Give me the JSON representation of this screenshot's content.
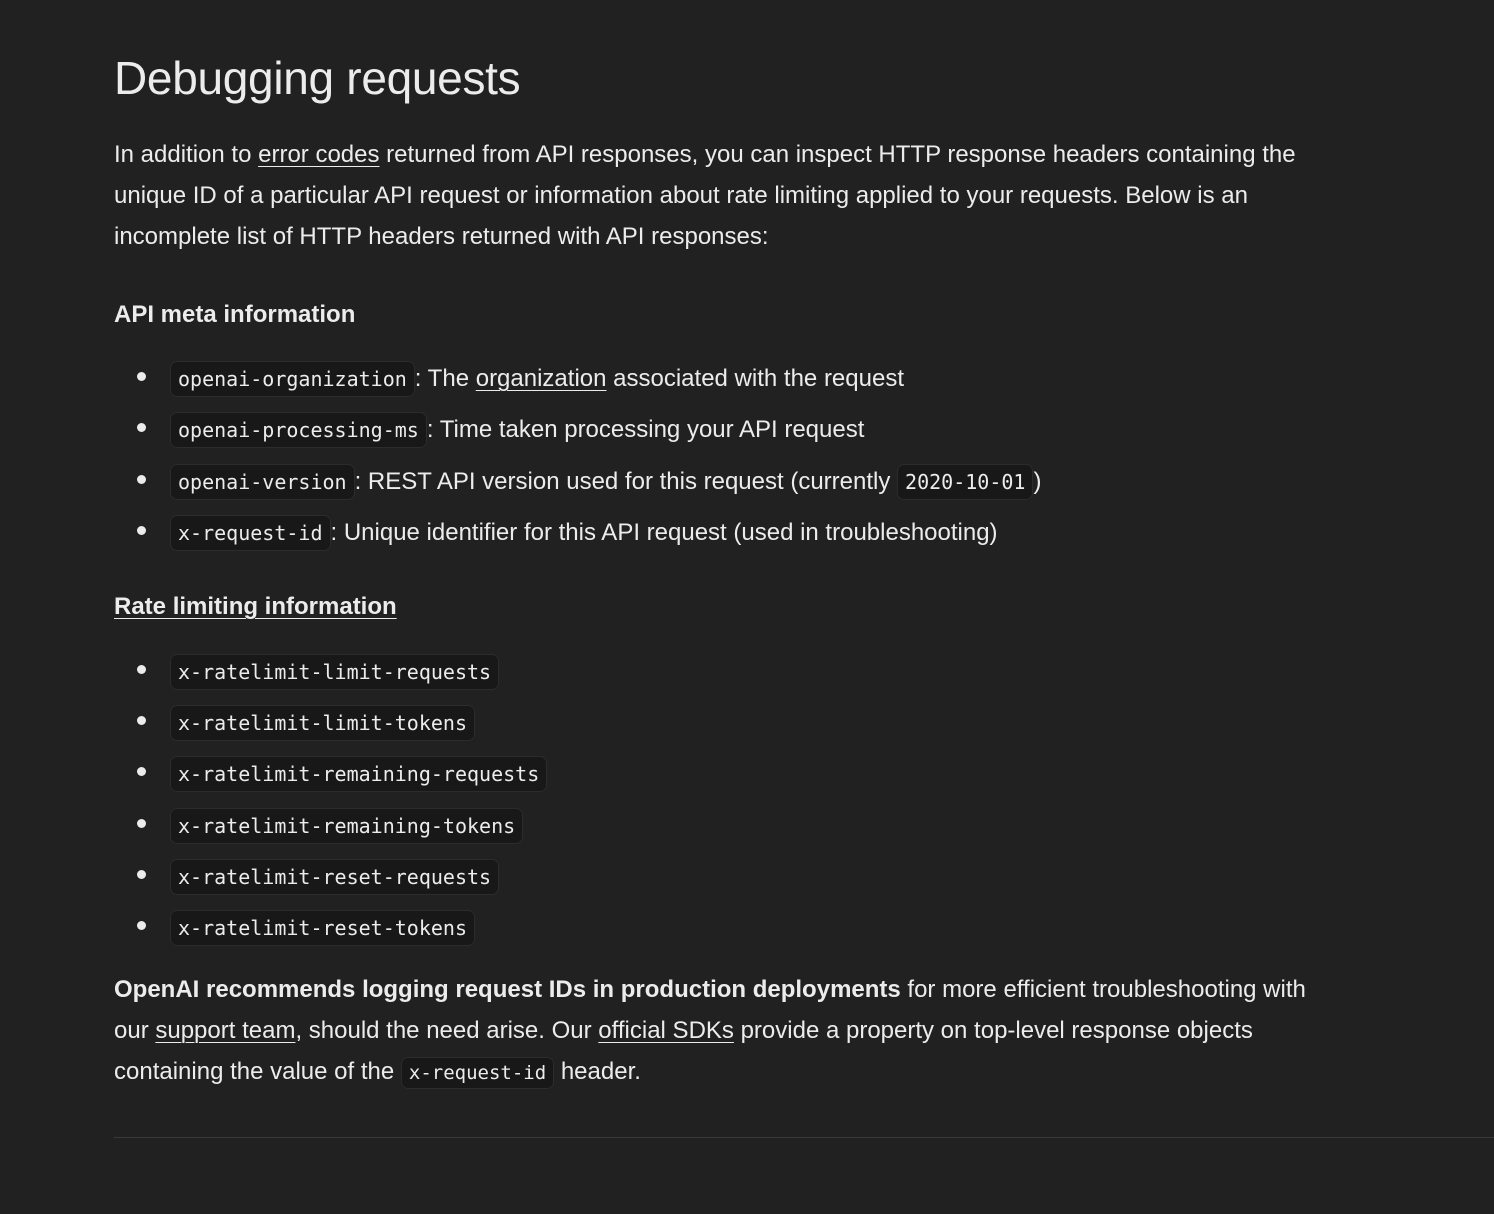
{
  "heading": "Debugging requests",
  "intro": {
    "before_link": "In addition to ",
    "link": "error codes",
    "after_link": " returned from API responses, you can inspect HTTP response headers containing the unique ID of a particular API request or information about rate limiting applied to your requests. Below is an incomplete list of HTTP headers returned with API responses:"
  },
  "meta_section": {
    "title": "API meta information",
    "items": [
      {
        "code": "openai-organization",
        "text_before": ": The ",
        "link": "organization",
        "text_after": " associated with the request"
      },
      {
        "code": "openai-processing-ms",
        "text": ": Time taken processing your API request"
      },
      {
        "code": "openai-version",
        "text": ": REST API version used for this request (currently ",
        "inline_code": "2020-10-01",
        "text_end": ")"
      },
      {
        "code": "x-request-id",
        "text": ": Unique identifier for this API request (used in troubleshooting)"
      }
    ]
  },
  "rate_section": {
    "title": "Rate limiting information",
    "items": [
      "x-ratelimit-limit-requests",
      "x-ratelimit-limit-tokens",
      "x-ratelimit-remaining-requests",
      "x-ratelimit-remaining-tokens",
      "x-ratelimit-reset-requests",
      "x-ratelimit-reset-tokens"
    ]
  },
  "closing": {
    "bold": "OpenAI recommends logging request IDs in production deployments",
    "text1": " for more efficient troubleshooting with our ",
    "link1": "support team",
    "text2": ", should the need arise. Our ",
    "link2": "official SDKs",
    "text3": " provide a property on top-level response objects containing the value of the ",
    "code": "x-request-id",
    "text4": " header."
  },
  "colors": {
    "background": "#212121",
    "text": "#ececec",
    "code_background": "#181818"
  }
}
